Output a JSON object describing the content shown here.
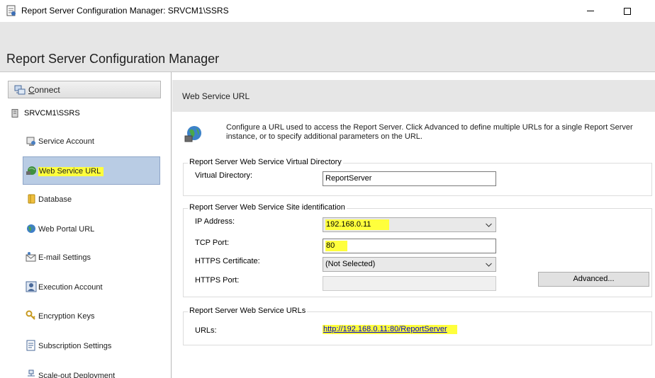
{
  "window": {
    "title": "Report Server Configuration Manager: SRVCM1\\SSRS"
  },
  "banner": {
    "title": "Report Server Configuration Manager"
  },
  "sidebar": {
    "connect_label": "Connect",
    "server_name": "SRVCM1\\SSRS",
    "items": [
      {
        "label": "Service Account",
        "icon": "service-account-icon",
        "selected": false
      },
      {
        "label": "Web Service URL",
        "icon": "web-service-icon",
        "selected": true
      },
      {
        "label": "Database",
        "icon": "database-icon",
        "selected": false
      },
      {
        "label": "Web Portal URL",
        "icon": "globe-icon",
        "selected": false
      },
      {
        "label": "E-mail Settings",
        "icon": "email-icon",
        "selected": false
      },
      {
        "label": "Execution Account",
        "icon": "execution-account-icon",
        "selected": false
      },
      {
        "label": "Encryption Keys",
        "icon": "keys-icon",
        "selected": false
      },
      {
        "label": "Subscription Settings",
        "icon": "subscription-icon",
        "selected": false
      },
      {
        "label": "Scale-out Deployment",
        "icon": "scale-out-icon",
        "selected": false
      }
    ]
  },
  "main": {
    "section_title": "Web Service URL",
    "description": "Configure a URL used to access the Report Server.  Click Advanced to define multiple URLs for a single Report Server instance, or to specify additional parameters on the URL.",
    "virtual_directory_group": {
      "title": "Report Server Web Service Virtual Directory",
      "label": "Virtual Directory:",
      "value": "ReportServer"
    },
    "site_group": {
      "title": "Report Server Web Service Site identification",
      "ip_label": "IP Address:",
      "ip_value": "192.168.0.11",
      "tcp_label": "TCP Port:",
      "tcp_value": "80",
      "cert_label": "HTTPS Certificate:",
      "cert_value": "(Not Selected)",
      "https_port_label": "HTTPS Port:",
      "https_port_value": "",
      "advanced_label": "Advanced..."
    },
    "urls_group": {
      "title": "Report Server Web Service URLs",
      "label": "URLs:",
      "url": "http://192.168.0.11:80/ReportServer"
    }
  },
  "colors": {
    "highlight": "#ffff3c",
    "selected_item": "#b9cce4",
    "banner": "#e6e6e6",
    "link": "#0000cc"
  }
}
